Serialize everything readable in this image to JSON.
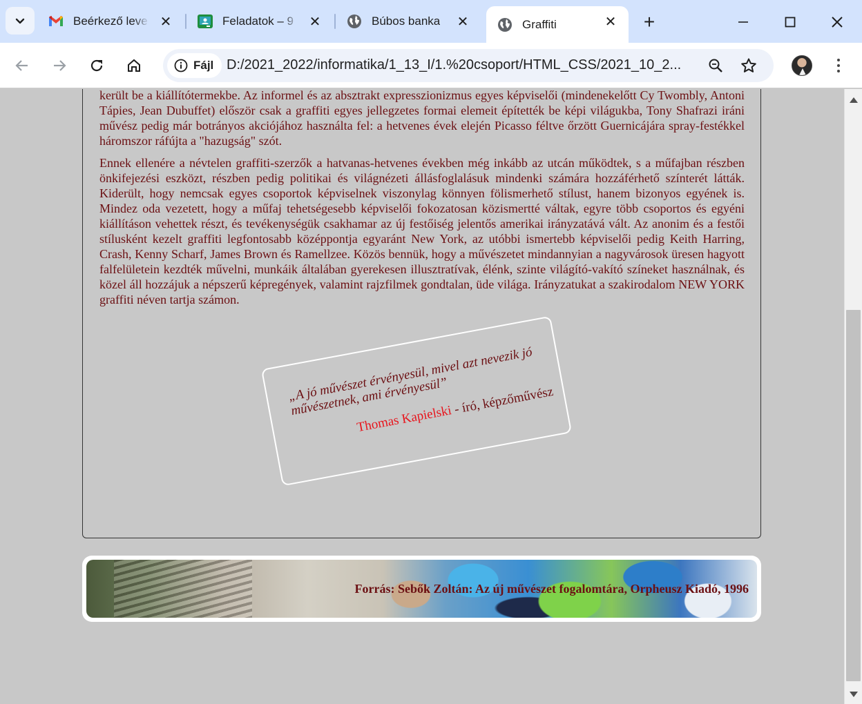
{
  "browser": {
    "tabs": [
      {
        "title": "Beérkező leve",
        "icon": "gmail-icon",
        "active": false
      },
      {
        "title": "Feladatok – 9",
        "icon": "classroom-icon",
        "active": false
      },
      {
        "title": "Búbos banka",
        "icon": "globe-icon",
        "active": false
      },
      {
        "title": "Graffiti",
        "icon": "globe-icon",
        "active": true
      }
    ],
    "omnibox": {
      "chip_label": "Fájl",
      "url": "D:/2021_2022/informatika/1_13_I/1.%20csoport/HTML_CSS/2021_10_2..."
    },
    "colors": {
      "tabbar": "#d3e3fd",
      "active_tab": "#ffffff",
      "omnibox": "#eef2fa"
    }
  },
  "page": {
    "paragraphs": [
      "került be a kiállítótermekbe. Az informel és az absztrakt expresszionizmus egyes képviselői (mindenekelőtt Cy Twombly, Antoni Tápies, Jean Dubuffet) először csak a graffiti egyes jellegzetes formai elemeit építették be képi világukba, Tony Shafrazi iráni művész pedig már botrányos akciójához használta fel: a hetvenes évek elején Picasso féltve őrzött Guernicájára spray-festékkel háromszor ráfújta a \"hazugság\" szót.",
      "Ennek ellenére a névtelen graffiti-szerzők a hatvanas-hetvenes években még inkább az utcán működtek, s a műfajban részben önkifejezési eszközt, részben pedig politikai és világnézeti állásfoglalásuk mindenki számára hozzáférhető színterét látták. Kiderült, hogy nemcsak egyes csoportok képviselnek viszonylag könnyen fölismerhető stílust, hanem bizonyos egyének is. Mindez oda vezetett, hogy a műfaj tehetségesebb képviselői fokozatosan közismertté váltak, egyre több csoportos és egyéni kiállításon vehettek részt, és tevékenységük csakhamar az új festőiség jelentős amerikai irányzatává vált. Az anonim és a festői stílusként kezelt graffiti legfontosabb középpontja egyaránt New York, az utóbbi ismertebb képviselői pedig Keith Harring, Crash, Kenny Scharf, James Brown és Ramellzee. Közös bennük, hogy a művészetet mindannyian a nagyvárosok üresen hagyott falfelületein kezdték művelni, munkáik általában gyerekesen illusztratívak, élénk, szinte világító-vakító színeket használnak, és közel áll hozzájuk a népszerű képregények, valamint rajzfilmek gondtalan, üde világa. Irányzatukat a szakirodalom NEW YORK graffiti néven tartja számon."
    ],
    "quote": {
      "text": "„A jó művészet érvényesül, mivel azt nevezik jó művészetnek, ami érvényesül”",
      "author": "Thomas Kapielski",
      "role": " - író, képzőművész"
    },
    "footer": {
      "source": "Forrás: Sebők Zoltán: Az új művészet fogalomtára, Orpheusz Kiadó, 1996"
    },
    "colors": {
      "background": "#c8c8c8",
      "text": "#6b0f12",
      "author_name": "#e8141c"
    }
  }
}
